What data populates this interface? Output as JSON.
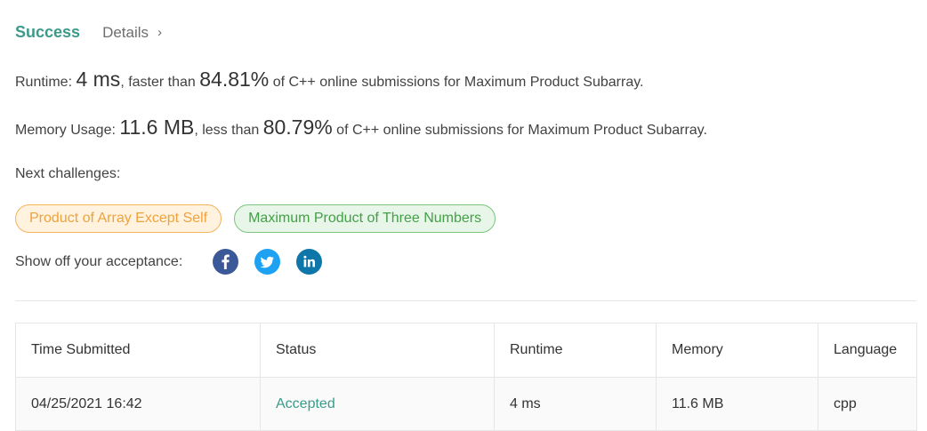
{
  "result": {
    "status": "Success",
    "details_label": "Details",
    "chevron": "›"
  },
  "runtime": {
    "label": "Runtime: ",
    "value": "4 ms",
    "mid": ", faster than ",
    "percent": "84.81%",
    "suffix": " of C++ online submissions for Maximum Product Subarray."
  },
  "memory": {
    "label": "Memory Usage: ",
    "value": "11.6 MB",
    "mid": ", less than ",
    "percent": "80.79%",
    "suffix": " of C++ online submissions for Maximum Product Subarray."
  },
  "next_challenges": {
    "label": "Next challenges:",
    "items": [
      {
        "label": "Product of Array Except Self",
        "color": "#f0a23a"
      },
      {
        "label": "Maximum Product of Three Numbers",
        "color": "#43a047"
      }
    ]
  },
  "share": {
    "label": "Show off your acceptance:",
    "icons": [
      {
        "name": "facebook-icon",
        "glyph": "f",
        "color": "#3b5998"
      },
      {
        "name": "twitter-icon",
        "glyph": "twitter-bird",
        "color": "#1da1f2"
      },
      {
        "name": "linkedin-icon",
        "glyph": "in",
        "color": "#0e76a8"
      }
    ]
  },
  "table": {
    "headers": [
      "Time Submitted",
      "Status",
      "Runtime",
      "Memory",
      "Language"
    ],
    "rows": [
      {
        "time": "04/25/2021 16:42",
        "status": "Accepted",
        "runtime": "4 ms",
        "memory": "11.6 MB",
        "language": "cpp"
      }
    ]
  },
  "colors": {
    "success": "#3b9b8a",
    "accepted": "#3b9b8a"
  }
}
